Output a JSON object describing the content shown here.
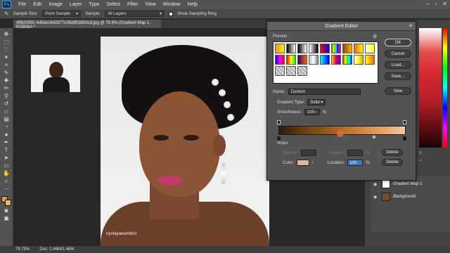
{
  "menu": {
    "logo": "Ps",
    "items": [
      "File",
      "Edit",
      "Image",
      "Layer",
      "Type",
      "Select",
      "Filter",
      "View",
      "Window",
      "Help"
    ]
  },
  "options_bar": {
    "sample_size_label": "Sample Size:",
    "sample_size_value": "Point Sample",
    "sample_label": "Sample:",
    "sample_value": "All Layers",
    "show_ring_label": "Show Sampling Ring"
  },
  "document": {
    "tab_title": "49624550 4d5be1642877e35d953859cd.jpg @ 79.8% (Gradient Map 1, RGB/8#) *",
    "watermark": "nyotayawambo1"
  },
  "status": {
    "zoom": "79.75%",
    "doc": "Doc: 1.46M/1.46M"
  },
  "layers": {
    "items": [
      {
        "name": "Gradient Map 1"
      },
      {
        "name": "Background"
      }
    ]
  },
  "gradient_editor": {
    "title": "Gradient Editor",
    "presets_label": "Presets",
    "buttons": {
      "ok": "OK",
      "cancel": "Cancel",
      "load": "Load...",
      "save": "Save...",
      "new": "New"
    },
    "name_label": "Name:",
    "name_value": "Custom",
    "gradient_type_label": "Gradient Type:",
    "gradient_type_value": "Solid",
    "smoothness_label": "Smoothness:",
    "smoothness_value": "100",
    "smoothness_unit": "%",
    "stops_label": "Stops",
    "opacity_label": "Opacity:",
    "location_label": "Location:",
    "location_value": "100",
    "percent": "%",
    "delete_label": "Delete",
    "color_label": "Color:"
  }
}
